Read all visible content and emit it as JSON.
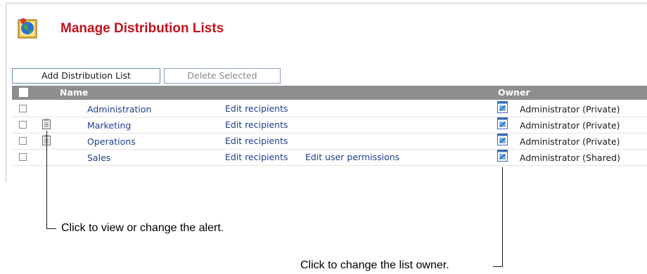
{
  "header": {
    "title": "Manage Distribution Lists",
    "icon": "distribution-lists-globe-icon"
  },
  "toolbar": {
    "add_label": "Add Distribution List",
    "delete_label": "Delete Selected"
  },
  "table": {
    "columns": {
      "name": "Name",
      "owner": "Owner"
    },
    "rows": [
      {
        "name": "Administration",
        "edit_recipients": "Edit recipients",
        "edit_permissions": "",
        "owner": "Administrator (Private)",
        "has_alert": false,
        "checked": false
      },
      {
        "name": "Marketing",
        "edit_recipients": "Edit recipients",
        "edit_permissions": "",
        "owner": "Administrator (Private)",
        "has_alert": true,
        "checked": false
      },
      {
        "name": "Operations",
        "edit_recipients": "Edit recipients",
        "edit_permissions": "",
        "owner": "Administrator (Private)",
        "has_alert": true,
        "checked": false
      },
      {
        "name": "Sales",
        "edit_recipients": "Edit recipients",
        "edit_permissions": "Edit user permissions",
        "owner": "Administrator (Shared)",
        "has_alert": false,
        "checked": false
      }
    ]
  },
  "callouts": {
    "alert": "Click to view or change the alert.",
    "owner": "Click to change the list owner."
  },
  "colors": {
    "title": "#c4121a",
    "link": "#1b3f8e",
    "header_bg": "#8e8e8e"
  }
}
